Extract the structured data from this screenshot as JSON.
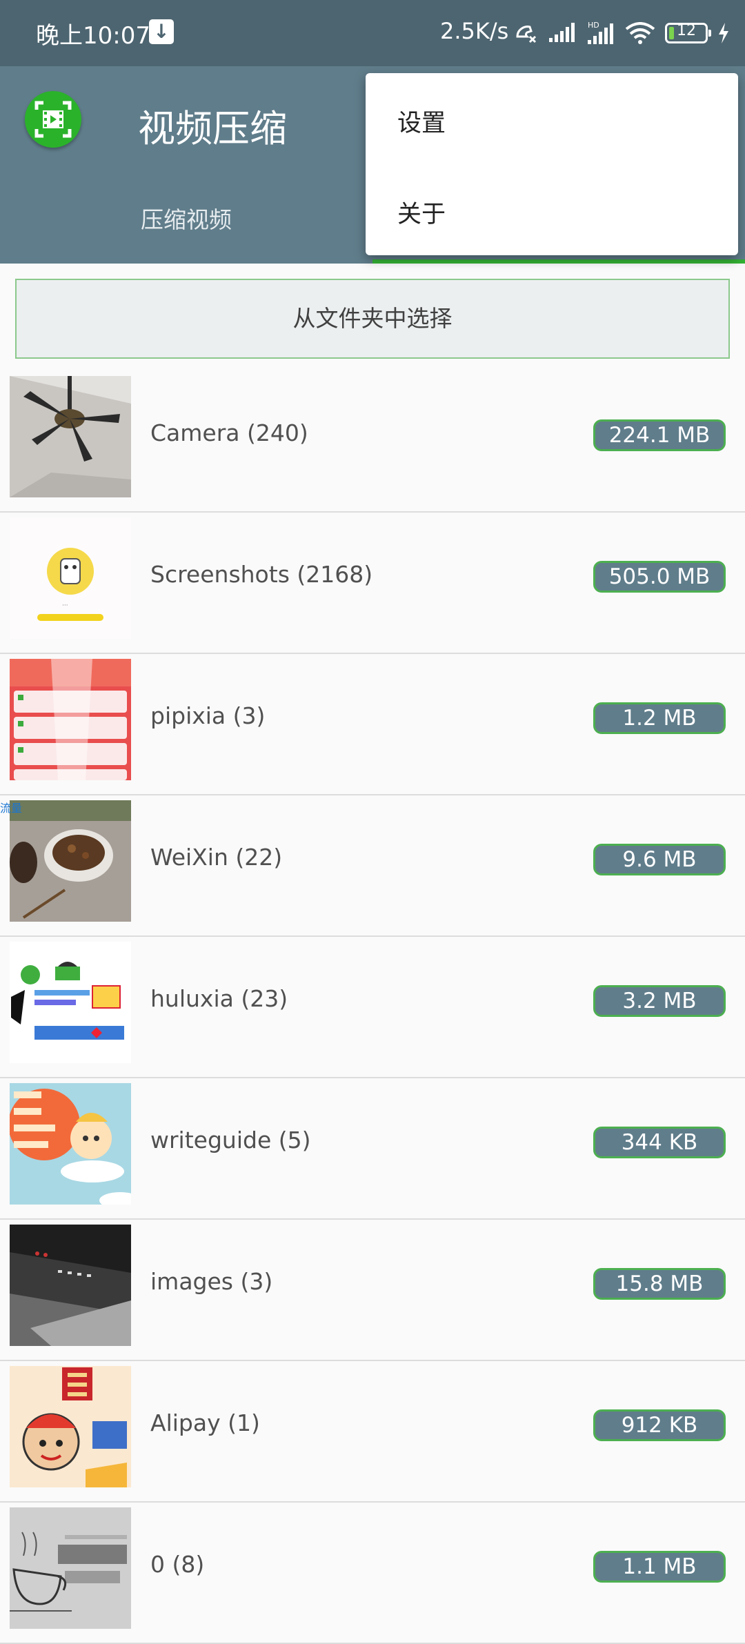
{
  "status_bar": {
    "time": "晚上10:07",
    "network_speed": "2.5K/s",
    "battery_level": "12",
    "icons": [
      "download-notify-icon",
      "call-icon",
      "signal-icon",
      "hd-signal-icon",
      "wifi-icon",
      "battery-icon",
      "charging-icon"
    ]
  },
  "app_bar": {
    "title": "视频压缩",
    "tab_label": "压缩视频",
    "accent_color": "#607d8b"
  },
  "overflow_menu": {
    "items": [
      {
        "label": "设置"
      },
      {
        "label": "关于"
      }
    ]
  },
  "choose_folder_label": "从文件夹中选择",
  "folders": [
    {
      "name": "Camera (240)",
      "size": "224.1 MB"
    },
    {
      "name": "Screenshots (2168)",
      "size": "505.0 MB"
    },
    {
      "name": "pipixia (3)",
      "size": "1.2 MB"
    },
    {
      "name": "WeiXin (22)",
      "size": "9.6 MB"
    },
    {
      "name": "huluxia (23)",
      "size": "3.2 MB"
    },
    {
      "name": "writeguide (5)",
      "size": "344 KB"
    },
    {
      "name": "images (3)",
      "size": "15.8 MB"
    },
    {
      "name": "Alipay (1)",
      "size": "912 KB"
    },
    {
      "name": "0 (8)",
      "size": "1.1 MB"
    }
  ],
  "watermark_text": "流量"
}
